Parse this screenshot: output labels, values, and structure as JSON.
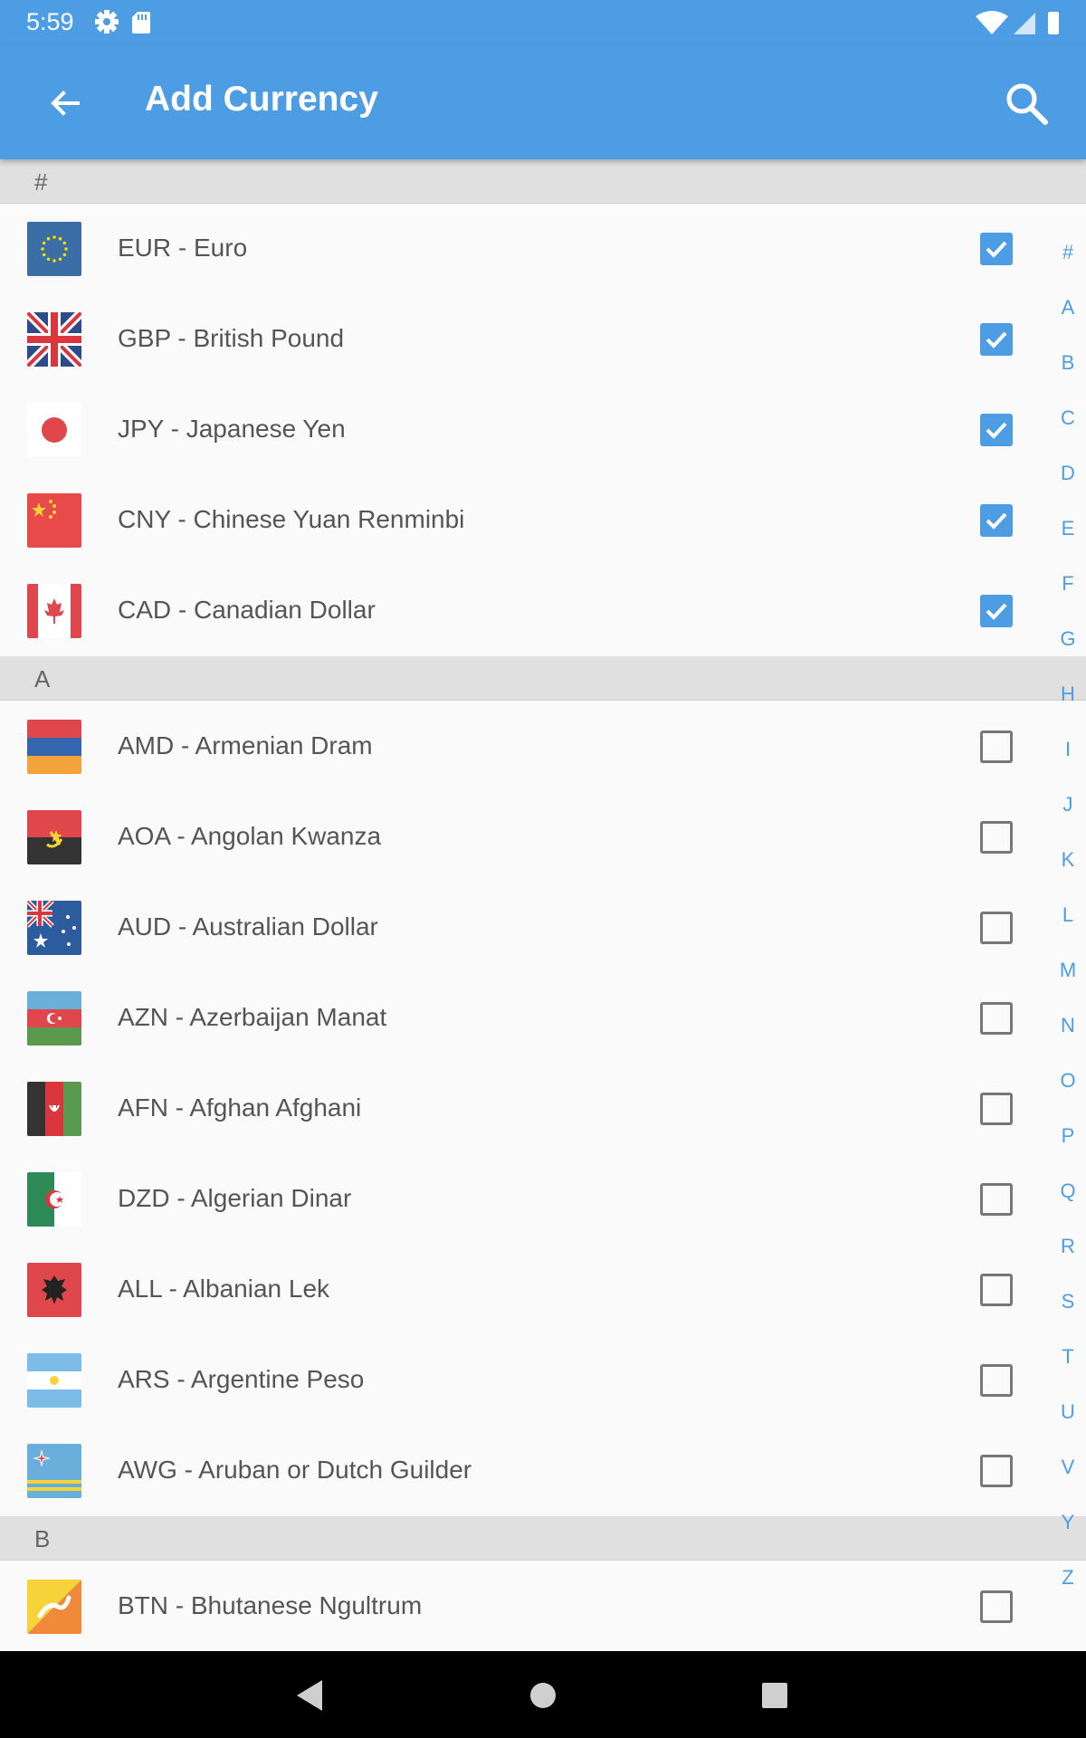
{
  "status_bar": {
    "time": "5:59"
  },
  "app_bar": {
    "title": "Add Currency"
  },
  "sections": [
    {
      "header": "#",
      "items": [
        {
          "label": "EUR - Euro",
          "checked": true,
          "flag": "eu"
        },
        {
          "label": "GBP - British Pound",
          "checked": true,
          "flag": "gb"
        },
        {
          "label": "JPY - Japanese Yen",
          "checked": true,
          "flag": "jp"
        },
        {
          "label": "CNY - Chinese Yuan Renminbi",
          "checked": true,
          "flag": "cn"
        },
        {
          "label": "CAD - Canadian Dollar",
          "checked": true,
          "flag": "ca"
        }
      ]
    },
    {
      "header": "A",
      "items": [
        {
          "label": "AMD - Armenian Dram",
          "checked": false,
          "flag": "am"
        },
        {
          "label": "AOA - Angolan Kwanza",
          "checked": false,
          "flag": "ao"
        },
        {
          "label": "AUD - Australian Dollar",
          "checked": false,
          "flag": "au"
        },
        {
          "label": "AZN - Azerbaijan Manat",
          "checked": false,
          "flag": "az"
        },
        {
          "label": "AFN - Afghan Afghani",
          "checked": false,
          "flag": "af"
        },
        {
          "label": "DZD - Algerian Dinar",
          "checked": false,
          "flag": "dz"
        },
        {
          "label": "ALL - Albanian Lek",
          "checked": false,
          "flag": "al"
        },
        {
          "label": "ARS - Argentine Peso",
          "checked": false,
          "flag": "ar"
        },
        {
          "label": "AWG - Aruban or Dutch Guilder",
          "checked": false,
          "flag": "aw"
        }
      ]
    },
    {
      "header": "B",
      "items": [
        {
          "label": "BTN - Bhutanese Ngultrum",
          "checked": false,
          "flag": "bt"
        }
      ]
    }
  ],
  "index_letters": [
    "#",
    "A",
    "B",
    "C",
    "D",
    "E",
    "F",
    "G",
    "H",
    "I",
    "J",
    "K",
    "L",
    "M",
    "N",
    "O",
    "P",
    "Q",
    "R",
    "S",
    "T",
    "U",
    "V",
    "Y",
    "Z"
  ],
  "colors": {
    "primary": "#4d9de5",
    "section_bg": "#e0e0e0",
    "text": "#555555"
  }
}
